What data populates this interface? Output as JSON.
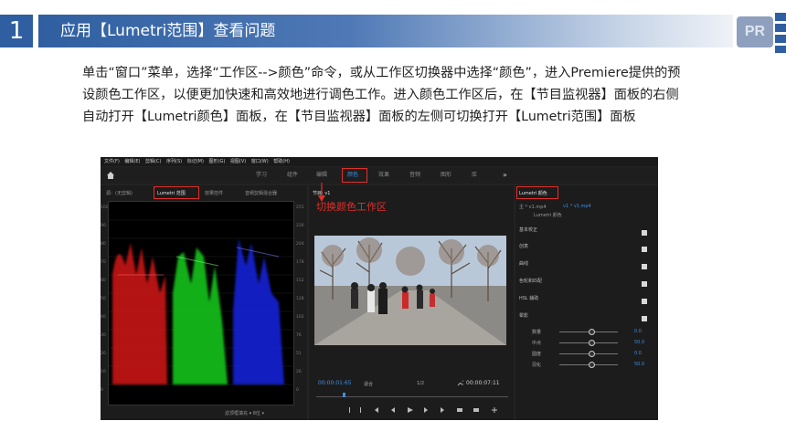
{
  "header": {
    "number": "1",
    "title": "应用【Lumetri范围】查看问题",
    "logo_text": "PR"
  },
  "paragraph": "单击“窗口”菜单，选择“工作区-->颜色”命令，或从工作区切换器中选择“颜色”，进入Premiere提供的预设颜色工作区，以便更加快速和高效地进行调色工作。进入颜色工作区后，在【节目监视器】面板的右侧自动打开【Lumetri颜色】面板，在【节目监视器】面板的左侧可切换打开【Lumetri范围】面板",
  "app": {
    "menus": [
      "文件(F)",
      "编辑(E)",
      "剪辑(C)",
      "序列(S)",
      "标记(M)",
      "图形(G)",
      "视图(V)",
      "窗口(W)",
      "帮助(H)"
    ],
    "workspaces": [
      "学习",
      "组件",
      "编辑",
      "颜色",
      "效果",
      "音频",
      "图形",
      "库"
    ],
    "active_workspace": "颜色",
    "more": "»",
    "left_tabs": {
      "source": "源：(无剪辑)",
      "lumetri_scopes": "Lumetri 范围",
      "effect_controls": "效果控件",
      "audio_mixer": "音频剪辑混合器"
    },
    "scope_ticks_left": [
      "100",
      "90",
      "80",
      "70",
      "60",
      "50",
      "40",
      "30",
      "20",
      "10",
      "0"
    ],
    "scope_ticks_right": [
      "255",
      "230",
      "204",
      "178",
      "152",
      "128",
      "102",
      "76",
      "51",
      "26",
      "0"
    ],
    "scope_footer": "滤顶框填充 ▾ 8位 ▾",
    "program_tab": "节目: v1",
    "annotation": "切换颜色工作区",
    "timecode_left": "00:00:01:65",
    "fit_label": "适合",
    "zoom_label": "1/2",
    "timecode_right": "00:00:07:11",
    "lumetri_tab": "Lumetri 颜色",
    "lumetri_clip_a": "主 * v1.mp4",
    "lumetri_clip_b": "v1 * v1.mp4",
    "lumetri_fx": "Lumetri 颜色",
    "sections": [
      "基本校正",
      "创意",
      "曲线",
      "色轮和匹配",
      "HSL 辅助",
      "晕影"
    ],
    "vignette_sliders": [
      {
        "label": "数量",
        "value": "0.0"
      },
      {
        "label": "中点",
        "value": "50.0"
      },
      {
        "label": "圆度",
        "value": "0.0"
      },
      {
        "label": "羽化",
        "value": "50.0"
      }
    ]
  },
  "colors": {
    "accent_blue": "#2f5fa0",
    "highlight_blue": "#3d8fe0",
    "annotation_red": "#e0302a"
  }
}
